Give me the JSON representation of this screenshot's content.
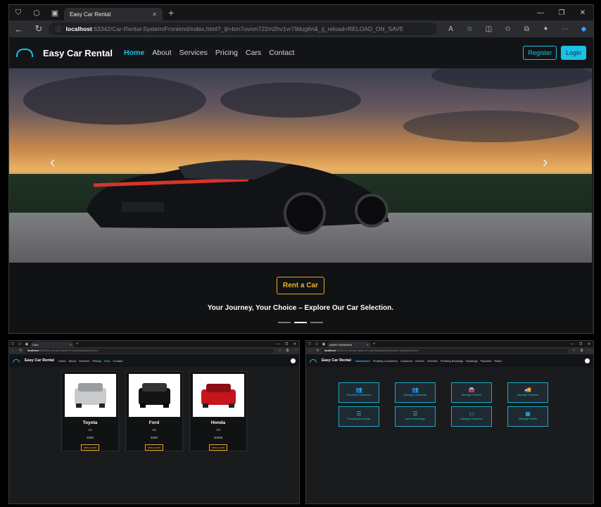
{
  "main": {
    "tab_title": "Easy Car Rental",
    "url_host": "localhost",
    "url_rest": ":63342/Car-Rental-System/Frontend/index.html?_ijt=bm7uvnm722m2hv1vr79dug6ri&_ij_reload=RELOAD_ON_SAVE",
    "brand": "Easy Car Rental",
    "nav": [
      "Home",
      "About",
      "Services",
      "Pricing",
      "Cars",
      "Contact"
    ],
    "register": "Register",
    "login": "Login",
    "rent_button": "Rent a Car",
    "tagline": "Your Journey, Your Choice – Explore Our Car Selection.",
    "carousel_active_slide": 2,
    "carousel_slides": 3
  },
  "cars_window": {
    "tab_title": "Cars",
    "url_host": "localhost",
    "url_rest": ":63342/Car-Rental-System/Frontend/pages/cars.html",
    "brand": "Easy Car Rental",
    "nav": [
      "Home",
      "About",
      "Services",
      "Pricing",
      "Cars",
      "Contact"
    ],
    "cards": [
      {
        "name": "Toyota",
        "model": "V1",
        "price": "2500",
        "button": "View more",
        "color": "#c9cacc"
      },
      {
        "name": "Ford",
        "model": "V2",
        "price": "5500",
        "button": "View more",
        "color": "#141414"
      },
      {
        "name": "Honda",
        "model": "V3",
        "price": "10000",
        "button": "View more",
        "color": "#c4161c"
      }
    ]
  },
  "admin_window": {
    "tab_title": "Admin Dashboard",
    "url_host": "localhost",
    "url_rest": ":63342/Car-Rental-System/Frontend/pages/admin/admin_dashboard.html",
    "brand": "Easy Car Rental",
    "nav": [
      "Dashboard",
      "Pending Customers",
      "Customer",
      "Drivers",
      "Vehicles",
      "Pending Bookings",
      "Bookings",
      "Payment",
      "Rates"
    ],
    "tiles": [
      "Pending Customers",
      "Manage Customer",
      "Manage Drivers",
      "Manage Vehicles",
      "Pending Bookings",
      "Active Bookings",
      "Manage Payment",
      "Manage Rates"
    ]
  },
  "colors": {
    "accent": "#19c3e8",
    "gold": "#e6a51f"
  }
}
